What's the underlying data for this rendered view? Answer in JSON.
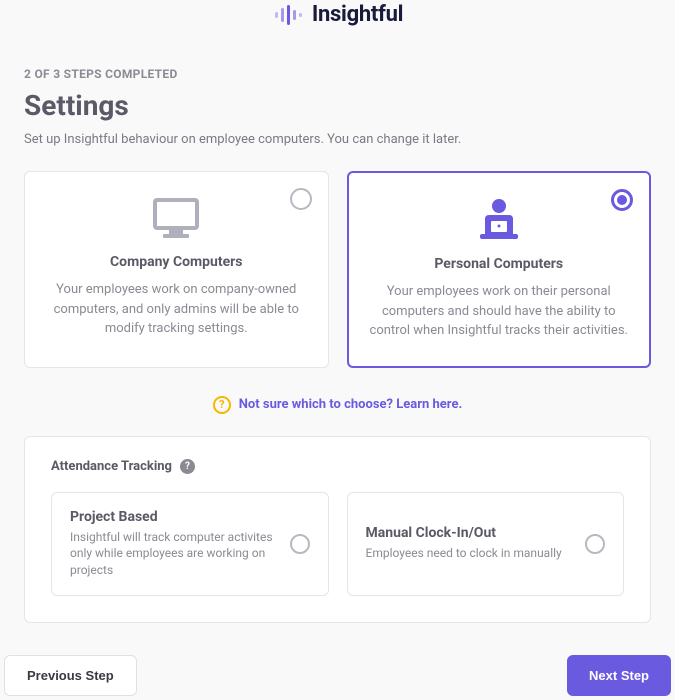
{
  "logo": {
    "text": "Insightful"
  },
  "progress": "2 OF 3 STEPS COMPLETED",
  "title": "Settings",
  "subtitle": "Set up Insightful behaviour on employee computers. You can change it later.",
  "options": {
    "company": {
      "title": "Company Computers",
      "desc": "Your employees work on company-owned computers, and only admins will be able to modify tracking settings."
    },
    "personal": {
      "title": "Personal Computers",
      "desc": "Your employees work on their personal computers and should have the ability to control when Insightful tracks their activities."
    }
  },
  "help": "Not sure which to choose? Learn here.",
  "section": {
    "title": "Attendance Tracking",
    "project": {
      "title": "Project Based",
      "desc": "Insightful will track computer activites only while employees are working on projects"
    },
    "manual": {
      "title": "Manual Clock-In/Out",
      "desc": "Employees need to clock in manually"
    }
  },
  "footer": {
    "prev": "Previous Step",
    "next": "Next Step"
  }
}
